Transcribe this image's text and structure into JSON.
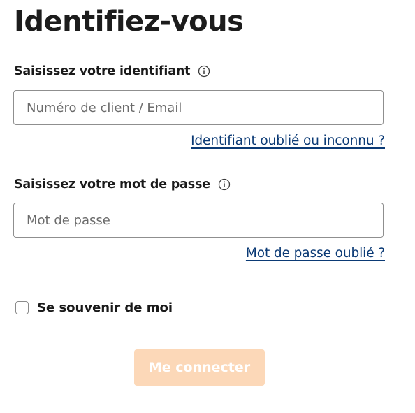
{
  "page": {
    "title": "Identifiez-vous"
  },
  "identifier": {
    "label": "Saisissez votre identifiant",
    "info_icon": "info-circle-icon",
    "placeholder": "Numéro de client / Email",
    "value": "",
    "forgot_link": "Identifiant oublié ou inconnu ?"
  },
  "password": {
    "label": "Saisissez votre mot de passe",
    "info_icon": "info-circle-icon",
    "placeholder": "Mot de passe",
    "value": "",
    "forgot_link": "Mot de passe oublié ?"
  },
  "remember_me": {
    "label": "Se souvenir de moi",
    "checked": false
  },
  "submit": {
    "label": "Me connecter",
    "disabled": true
  },
  "colors": {
    "link": "#0b3a75",
    "button_disabled_bg": "#fcd8b8",
    "input_border": "#8f8f8f"
  }
}
